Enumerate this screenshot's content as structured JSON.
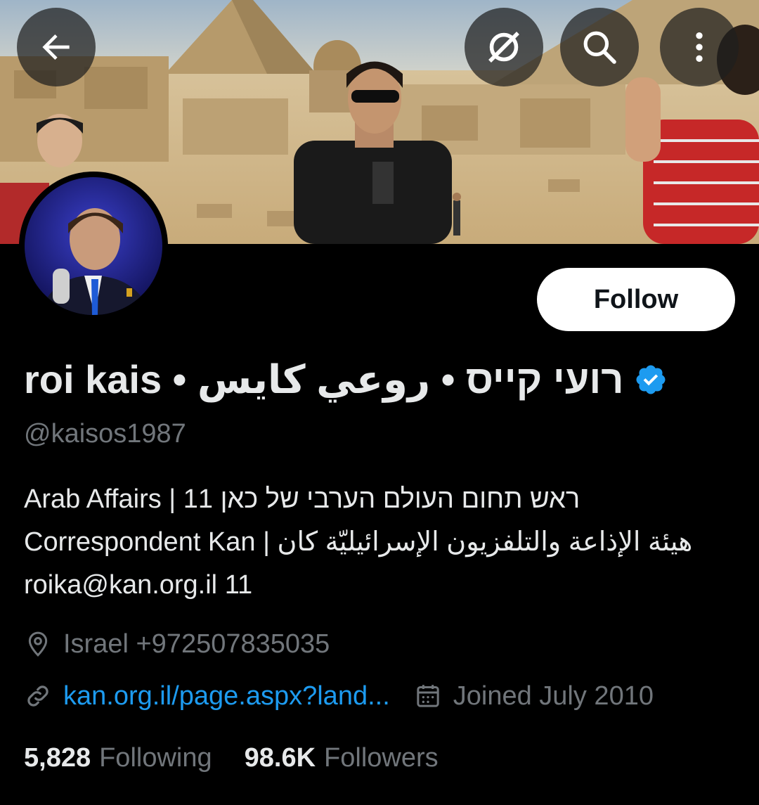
{
  "profile": {
    "display_name": "roi kais • רועי קייס • روعي كايس",
    "handle": "@kaisos1987",
    "follow_label": "Follow",
    "bio_lines": [
      "ראש תחום העולם הערבי של כאן 11 | Arab Affairs",
      "Correspondent Kan | هيئة الإذاعة والتلفزيون الإسرائيليّة كان",
      "11  roika@kan.org.il"
    ],
    "location": "Israel +972507835035",
    "link": "kan.org.il/page.aspx?land...",
    "joined": "Joined July 2010",
    "following_count": "5,828",
    "following_label": "Following",
    "followers_count": "98.6K",
    "followers_label": "Followers"
  },
  "icons": {
    "back": "arrow-left-icon",
    "grok": "grok-icon",
    "search": "search-icon",
    "more": "more-vertical-icon",
    "verified": "verified-badge-icon",
    "location": "location-pin-icon",
    "link": "link-icon",
    "calendar": "calendar-icon"
  },
  "colors": {
    "background": "#000000",
    "text_primary": "#e7e9ea",
    "text_secondary": "#71767b",
    "link": "#1d9bf0",
    "verified": "#1d9bf0"
  }
}
